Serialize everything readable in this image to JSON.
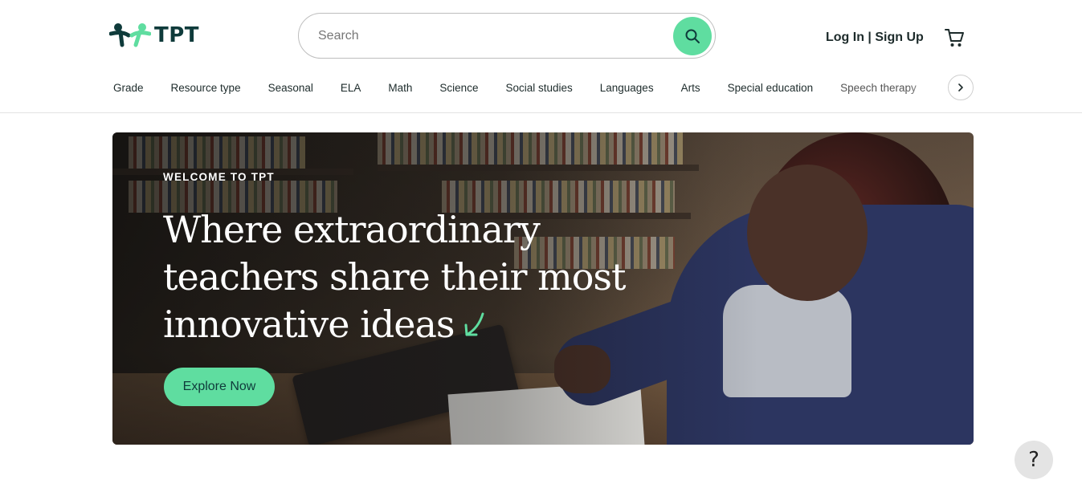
{
  "header": {
    "logo_text": "TPT",
    "search_placeholder": "Search",
    "login_label": "Log In | Sign Up"
  },
  "nav": {
    "items": [
      "Grade",
      "Resource type",
      "Seasonal",
      "ELA",
      "Math",
      "Science",
      "Social studies",
      "Languages",
      "Arts",
      "Special education",
      "Speech therapy"
    ]
  },
  "hero": {
    "eyebrow": "WELCOME TO TPT",
    "headline_line1": "Where extraordinary",
    "headline_line2": "teachers share their most",
    "headline_line3": "innovative ideas",
    "cta_label": "Explore Now"
  },
  "help": {
    "label": "?"
  },
  "colors": {
    "brand_green": "#5fdda0",
    "brand_dark": "#0f3b3b"
  },
  "icons": [
    "tpt-logo-icon",
    "search-icon",
    "cart-icon",
    "chevron-right-icon",
    "arrow-down-left-icon",
    "help-icon"
  ]
}
